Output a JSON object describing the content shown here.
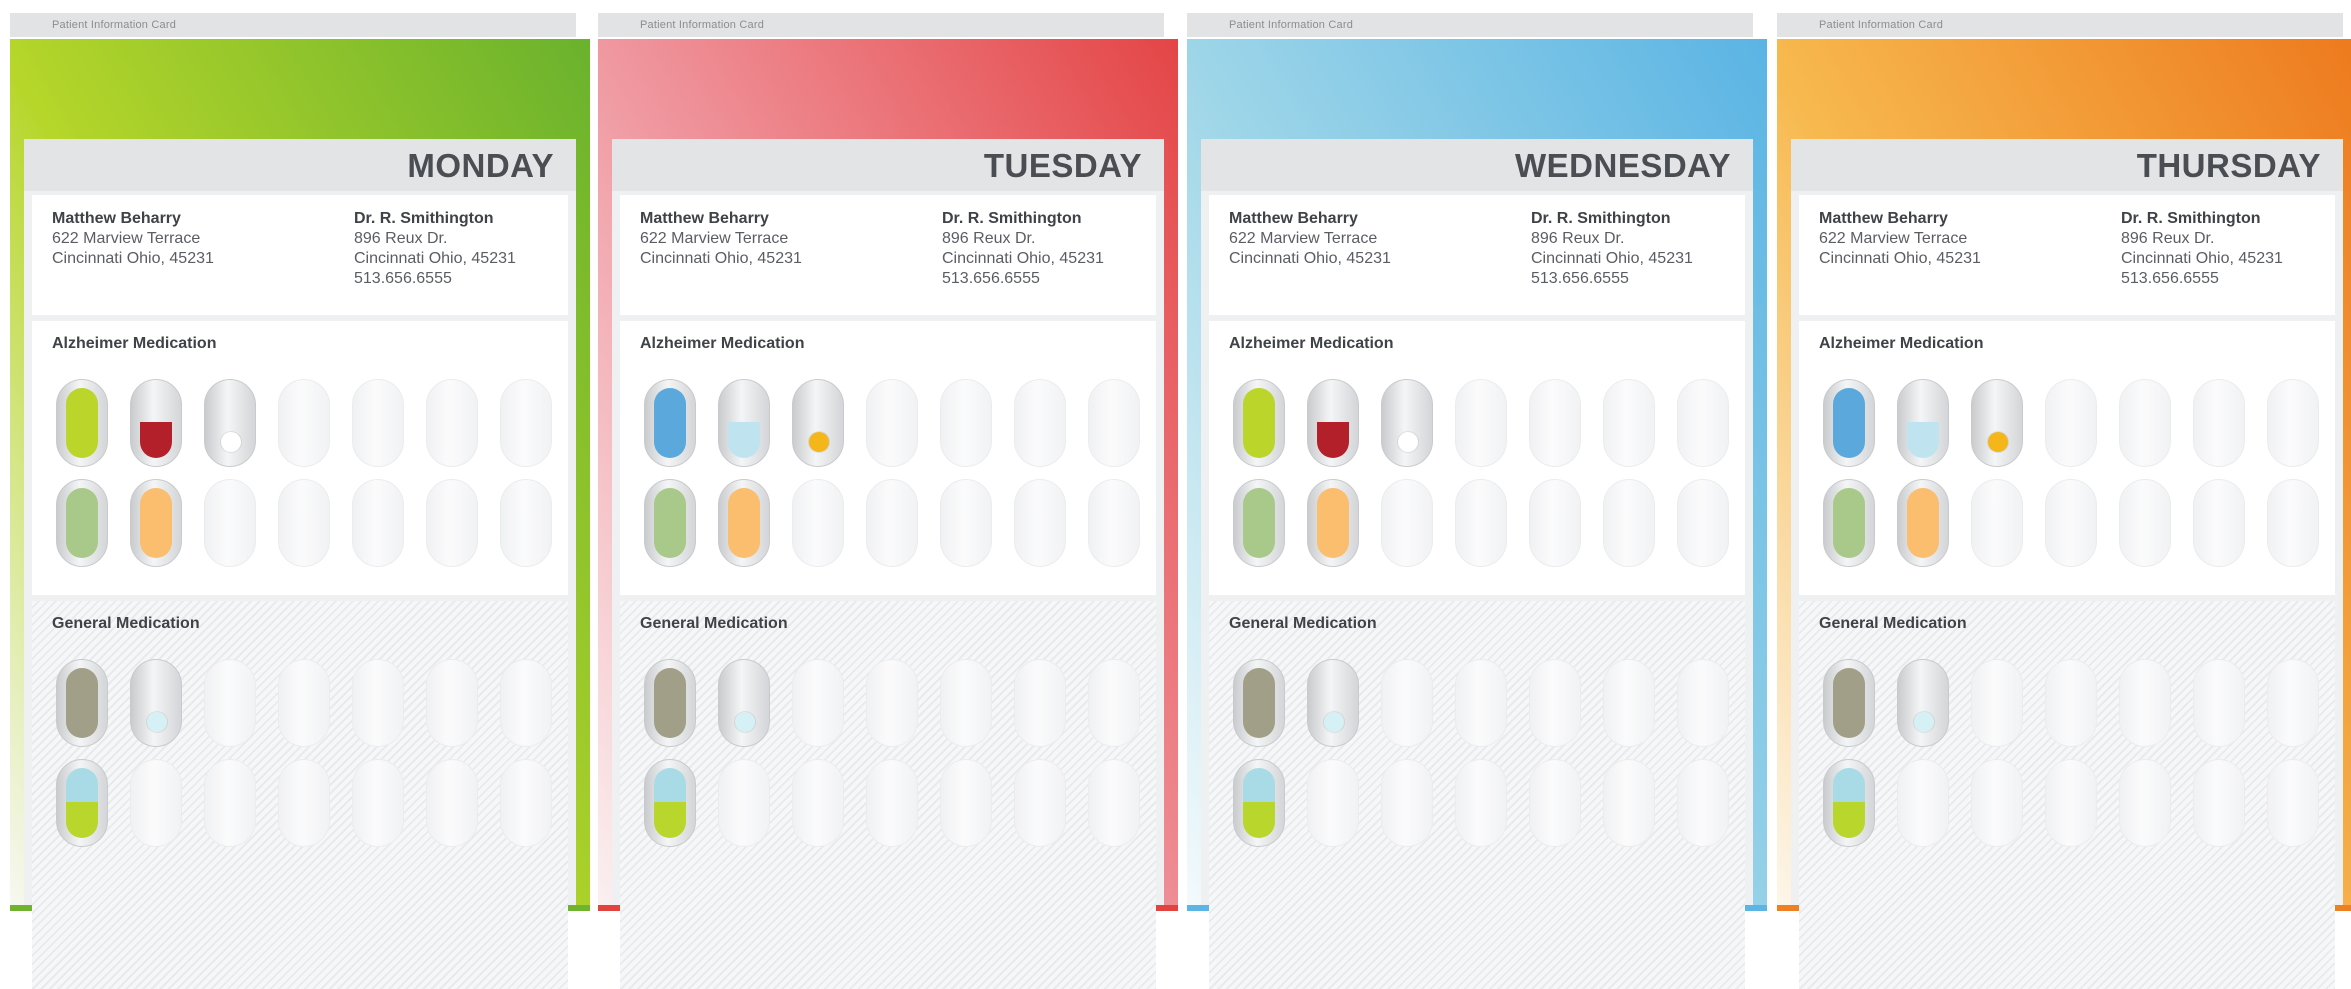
{
  "tab_label": "Patient Information Card",
  "patient": {
    "name": "Matthew Beharry",
    "street": "622 Marview Terrace",
    "city": "Cincinnati Ohio, 45231"
  },
  "doctor": {
    "name": "Dr. R. Smithington",
    "street": "896 Reux Dr.",
    "city": "Cincinnati Ohio, 45231",
    "phone": "513.656.6555"
  },
  "sections": {
    "alzheimer": "Alzheimer Medication",
    "general": "General Medication"
  },
  "cards": [
    {
      "day": "MONDAY",
      "color_from": "#f7f8f2",
      "color_mid": "#b6d62a",
      "color_to": "#6ab22d",
      "border": "#6fb32f",
      "alz_row1": [
        {
          "kind": "med",
          "color": "#bcd52a"
        },
        {
          "kind": "half",
          "color": "#b3202a"
        },
        {
          "kind": "dot",
          "color": "#ffffff"
        }
      ],
      "alz_row2": [
        {
          "kind": "med",
          "color": "#a8c98a"
        },
        {
          "kind": "med",
          "color": "#fbbd6e"
        }
      ],
      "gen_row1": [
        {
          "kind": "med",
          "color": "#a19f88"
        },
        {
          "kind": "dot",
          "color": "#d6f1f5"
        }
      ],
      "gen_row2": [
        {
          "kind": "half",
          "color": "#b9d62c",
          "top": "#a8dbe6"
        }
      ]
    },
    {
      "day": "TUESDAY",
      "color_from": "#fbf0f1",
      "color_mid": "#f09aa2",
      "color_to": "#e44546",
      "border": "#e2433f",
      "alz_row1": [
        {
          "kind": "med",
          "color": "#5ba9dc"
        },
        {
          "kind": "half",
          "color": "#bfe3ef"
        },
        {
          "kind": "dot",
          "color": "#f5b61a"
        }
      ],
      "alz_row2": [
        {
          "kind": "med",
          "color": "#a8c98a"
        },
        {
          "kind": "med",
          "color": "#fbbd6e"
        }
      ],
      "gen_row1": [
        {
          "kind": "med",
          "color": "#a19f88"
        },
        {
          "kind": "dot",
          "color": "#d6f1f5"
        }
      ],
      "gen_row2": [
        {
          "kind": "half",
          "color": "#b9d62c",
          "top": "#a8dbe6"
        }
      ]
    },
    {
      "day": "WEDNESDAY",
      "color_from": "#f3fafc",
      "color_mid": "#9fd6e8",
      "color_to": "#5ab4e4",
      "border": "#5cb5e3",
      "alz_row1": [
        {
          "kind": "med",
          "color": "#bcd52a"
        },
        {
          "kind": "half",
          "color": "#b3202a"
        },
        {
          "kind": "dot",
          "color": "#ffffff"
        }
      ],
      "alz_row2": [
        {
          "kind": "med",
          "color": "#a8c98a"
        },
        {
          "kind": "med",
          "color": "#fbbd6e"
        }
      ],
      "gen_row1": [
        {
          "kind": "med",
          "color": "#a19f88"
        },
        {
          "kind": "dot",
          "color": "#d6f1f5"
        }
      ],
      "gen_row2": [
        {
          "kind": "half",
          "color": "#b9d62c",
          "top": "#a8dbe6"
        }
      ]
    },
    {
      "day": "THURSDAY",
      "color_from": "#fdf6ea",
      "color_mid": "#f7b94e",
      "color_to": "#ed7a1e",
      "border": "#ee7f23",
      "alz_row1": [
        {
          "kind": "med",
          "color": "#5ba9dc"
        },
        {
          "kind": "half",
          "color": "#bfe3ef"
        },
        {
          "kind": "dot",
          "color": "#f5b61a"
        }
      ],
      "alz_row2": [
        {
          "kind": "med",
          "color": "#a8c98a"
        },
        {
          "kind": "med",
          "color": "#fbbd6e"
        }
      ],
      "gen_row1": [
        {
          "kind": "med",
          "color": "#a19f88"
        },
        {
          "kind": "dot",
          "color": "#d6f1f5"
        }
      ],
      "gen_row2": [
        {
          "kind": "half",
          "color": "#b9d62c",
          "top": "#a8dbe6"
        }
      ]
    }
  ]
}
